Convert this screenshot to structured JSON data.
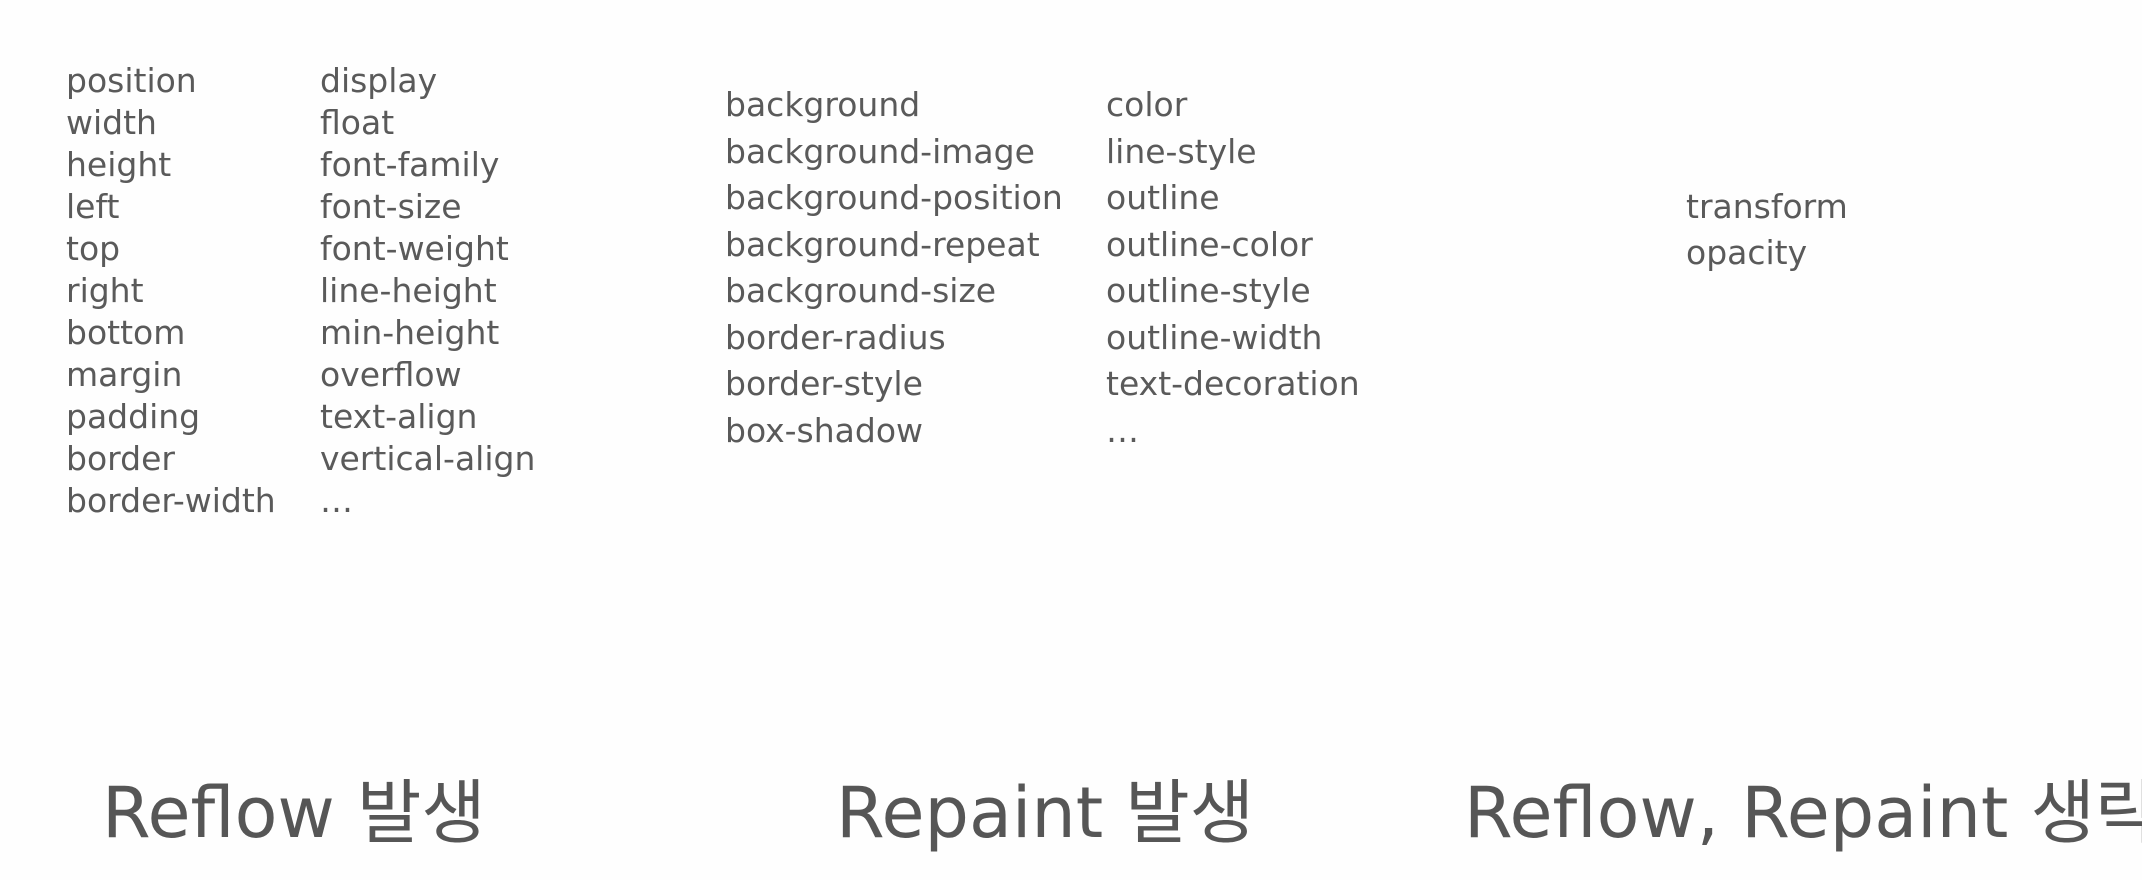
{
  "groups": {
    "reflow": {
      "column1": [
        "position",
        "width",
        "height",
        "left",
        "top",
        "right",
        "bottom",
        "margin",
        "padding",
        "border",
        "border-width"
      ],
      "column2": [
        "display",
        "float",
        "font-family",
        "font-size",
        "font-weight",
        "line-height",
        "min-height",
        "overflow",
        "text-align",
        "vertical-align",
        "…"
      ],
      "caption": "Reflow 발생"
    },
    "repaint": {
      "column1": [
        "background",
        "background-image",
        "background-position",
        "background-repeat",
        "background-size",
        "border-radius",
        "border-style",
        "box-shadow"
      ],
      "column2": [
        "color",
        "line-style",
        "outline",
        "outline-color",
        "outline-style",
        "outline-width",
        "text-decoration",
        "…"
      ],
      "caption": "Repaint 발생"
    },
    "none": {
      "column1": [
        "transform",
        "opacity"
      ],
      "caption": "Reflow, Repaint 생략"
    }
  },
  "colors": {
    "text": "#5a5a5a",
    "caption": "#565656",
    "background": "#fefefe"
  }
}
